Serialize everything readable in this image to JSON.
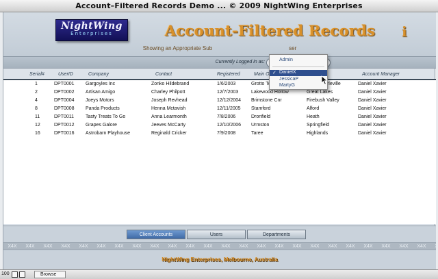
{
  "window": {
    "title": "Account–Filtered Records Demo  ...  © 2009 NightWing Enterprises"
  },
  "logo": {
    "main": "NightWing",
    "sub": "Enterprises"
  },
  "header": {
    "title": "Account-Filtered Records",
    "info_icon": "i",
    "subtitle_left": "Showing an Appropriate Sub",
    "subtitle_right": "ser"
  },
  "login": {
    "label": "Currently Logged in as:"
  },
  "dropdown": {
    "admin": "Admin",
    "users": [
      "DanielX",
      "JessicaP",
      "MartyG"
    ],
    "selected_index": 0,
    "check": "✓"
  },
  "columns": {
    "serial": "Serial#",
    "userid": "UserID",
    "company": "Company",
    "contact": "Contact",
    "registered": "Registered",
    "main": "Main O",
    "manager": "Account Manager"
  },
  "records": [
    {
      "serial": "1",
      "userid": "DPT0001",
      "company": "Gargoyles Inc",
      "contact": "Zonko Hildebrand",
      "registered": "1/6/2003",
      "address": "Grotto Towers",
      "city": "South Murleville",
      "manager": "Daniel Xavier"
    },
    {
      "serial": "2",
      "userid": "DPT0002",
      "company": "Artisan Amigo",
      "contact": "Charley Philpott",
      "registered": "12/7/2003",
      "address": "Lakewood Hollow",
      "city": "Great Lakes",
      "manager": "Daniel Xavier"
    },
    {
      "serial": "4",
      "userid": "DPT0004",
      "company": "Joeys Motors",
      "contact": "Joseph Revhead",
      "registered": "12/12/2004",
      "address": "Brimstone Cnr",
      "city": "Firebush Valley",
      "manager": "Daniel Xavier"
    },
    {
      "serial": "8",
      "userid": "DPT0008",
      "company": "Panda Products",
      "contact": "Henna Mctavish",
      "registered": "12/11/2005",
      "address": "Stamford",
      "city": "Alford",
      "manager": "Daniel Xavier"
    },
    {
      "serial": "11",
      "userid": "DPT0011",
      "company": "Tasty Treats To Go",
      "contact": "Anna Learmonth",
      "registered": "7/8/2006",
      "address": "Dronfield",
      "city": "Heath",
      "manager": "Daniel Xavier"
    },
    {
      "serial": "12",
      "userid": "DPT0012",
      "company": "Grapes Galore",
      "contact": "Jeeves McCarty",
      "registered": "12/10/2006",
      "address": "Urmston",
      "city": "Springfield",
      "manager": "Daniel Xavier"
    },
    {
      "serial": "16",
      "userid": "DPT0016",
      "company": "Astrobarn Playhouse",
      "contact": "Reginald Cricker",
      "registered": "7/9/2008",
      "address": "Taree",
      "city": "Highlands",
      "manager": "Daniel Xavier"
    }
  ],
  "tabs": [
    {
      "label": "Client Accounts",
      "active": true
    },
    {
      "label": "Users",
      "active": false
    },
    {
      "label": "Departments",
      "active": false
    }
  ],
  "pattern": {
    "text": "X4X",
    "count": 25
  },
  "footer": {
    "text": "NightWing Enterprises, Melbourne, Australia"
  },
  "status": {
    "zoom": "100",
    "mode": "Browse"
  },
  "colors": {
    "accent": "#d8902a",
    "selection": "#2f4f8f",
    "tab_active": "#3f6aa6"
  }
}
